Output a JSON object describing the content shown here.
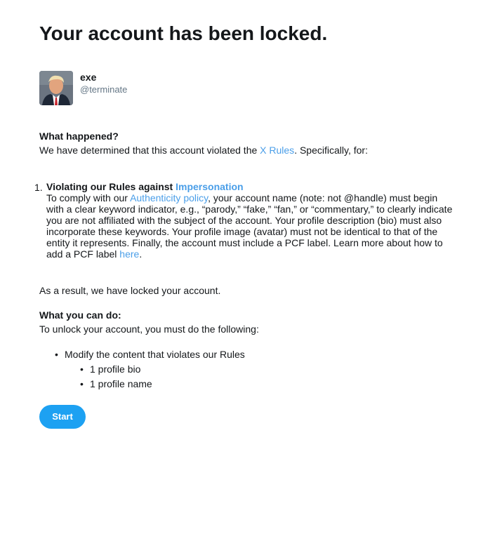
{
  "header": {
    "title": "Your account has been locked."
  },
  "account": {
    "name": "exe",
    "handle": "@terminate"
  },
  "what_happened": {
    "heading": "What happened?",
    "text_before": "We have determined that this account violated the ",
    "rules_link": "X Rules",
    "text_after": ". Specifically, for:"
  },
  "violation": {
    "number": "1.",
    "title": "Violating our Rules against ",
    "title_link": "Impersonation",
    "line1_before": "To comply with our ",
    "policy_link": "Authenticity policy",
    "line1_after": ", your account name (note: not @handle) must begin",
    "line2": "with a clear keyword indicator, e.g., “parody,” “fake,” “fan,” or “commentary,” to clearly indicate",
    "line3": "you are not affiliated with the subject of the account. Your profile description (bio) must also",
    "line4": "incorporate these keywords. Your profile image (avatar) must not be identical to that of the",
    "line5": "entity it represents. Finally, the account must include a PCF label. Learn more about how to",
    "line6_before": "add a PCF label ",
    "here_link": "here",
    "line6_after": "."
  },
  "result": {
    "text": "As a result, we have locked your account."
  },
  "what_you_can_do": {
    "heading": "What you can do:",
    "text": "To unlock your account, you must do the following:"
  },
  "steps": {
    "main": "Modify the content that violates our Rules",
    "sub": [
      "1 profile bio",
      "1 profile name"
    ]
  },
  "actions": {
    "start_label": "Start"
  },
  "colors": {
    "link": "#4a9ee8",
    "button": "#1da1f2",
    "text": "#14171a",
    "muted": "#657786"
  }
}
